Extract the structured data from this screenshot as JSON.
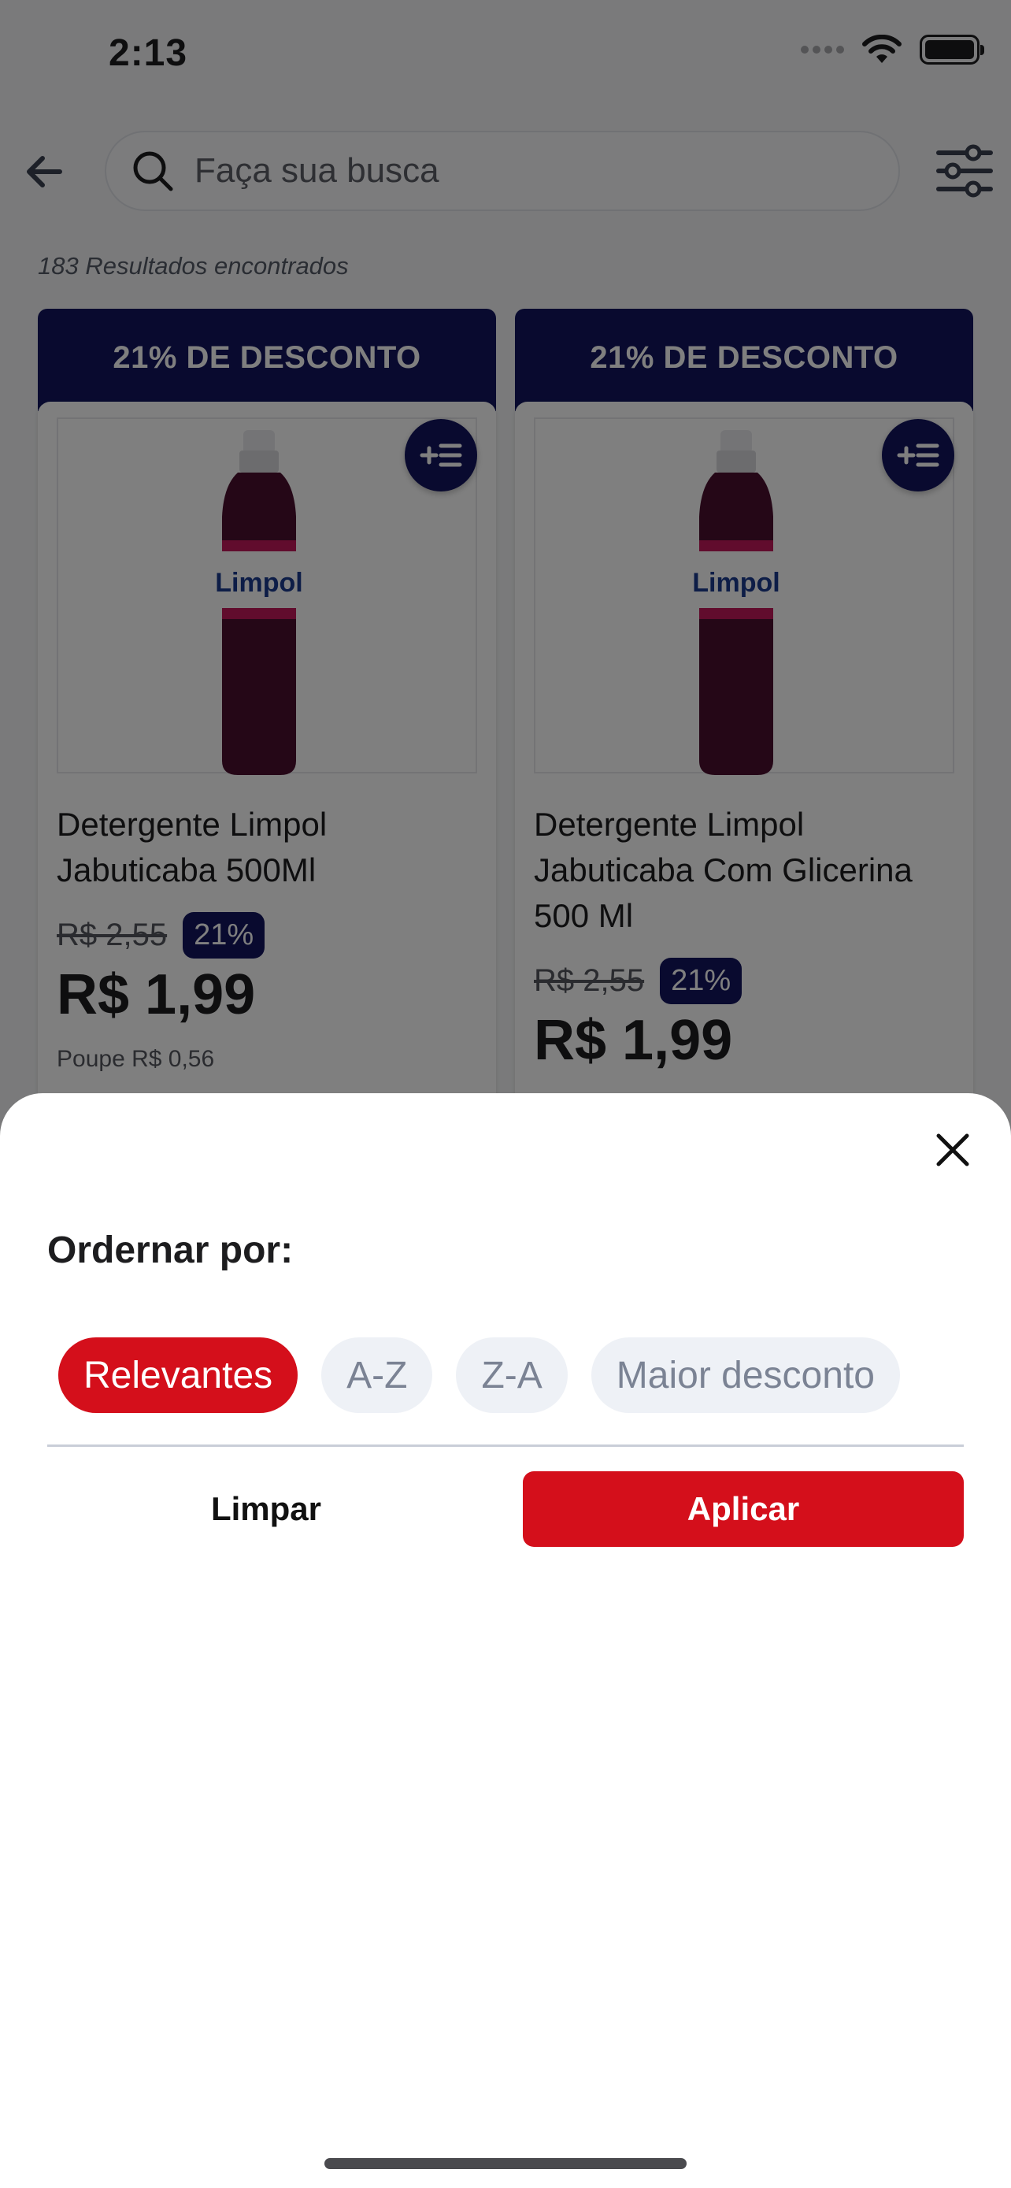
{
  "status_bar": {
    "time": "2:13"
  },
  "search": {
    "placeholder": "Faça sua busca",
    "value": ""
  },
  "results": {
    "text": "183 Resultados encontrados"
  },
  "products": [
    {
      "banner": "21% DE DESCONTO",
      "name": "Detergente Limpol Jabuticaba 500Ml",
      "old_price": "R$ 2,55",
      "discount": "21%",
      "price": "R$ 1,99",
      "savings": "Poupe R$ 0,56",
      "brand_logo": "Limpol"
    },
    {
      "banner": "21% DE DESCONTO",
      "name": "Detergente Limpol Jabuticaba Com Glicerina 500 Ml",
      "old_price": "R$ 2,55",
      "discount": "21%",
      "price": "R$ 1,99",
      "brand_logo": "Limpol"
    }
  ],
  "sort_sheet": {
    "title": "Ordernar por:",
    "options": [
      "Relevantes",
      "A-Z",
      "Z-A",
      "Maior desconto"
    ],
    "selected": "Relevantes",
    "clear_label": "Limpar",
    "apply_label": "Aplicar"
  },
  "icons": [
    "back-arrow-icon",
    "search-icon",
    "filter-sliders-icon",
    "add-to-list-icon",
    "close-icon",
    "wifi-icon",
    "battery-icon"
  ],
  "colors": {
    "navy": "#12155f",
    "red": "#d40f1b",
    "chip_bg": "#eef1f6"
  }
}
